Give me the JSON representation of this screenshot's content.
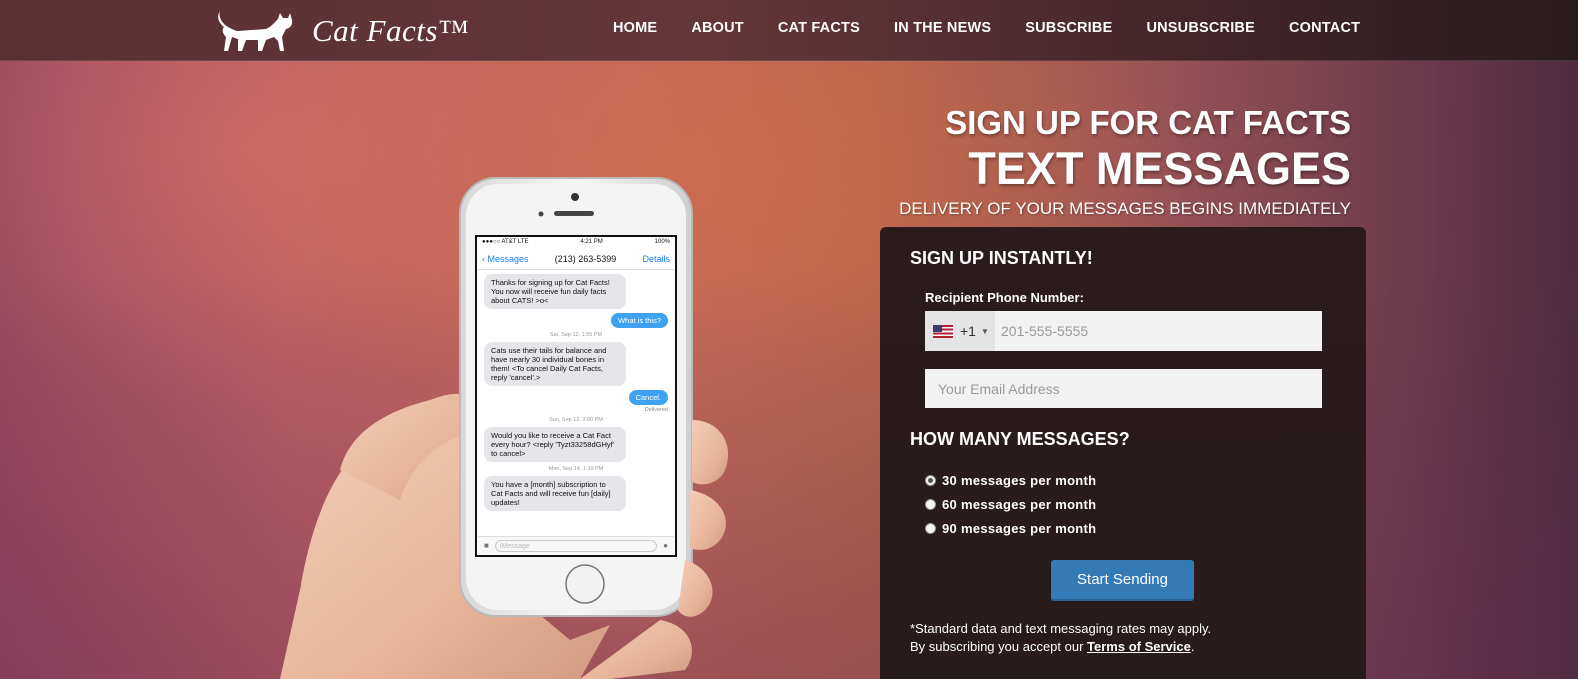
{
  "brand": {
    "name": "Cat Facts™"
  },
  "nav": [
    {
      "label": "HOME"
    },
    {
      "label": "ABOUT"
    },
    {
      "label": "CAT FACTS"
    },
    {
      "label": "IN THE NEWS"
    },
    {
      "label": "SUBSCRIBE"
    },
    {
      "label": "UNSUBSCRIBE"
    },
    {
      "label": "CONTACT"
    }
  ],
  "hero": {
    "line1": "SIGN UP FOR CAT FACTS",
    "line2": "TEXT MESSAGES",
    "line3": "DELIVERY OF YOUR MESSAGES BEGINS IMMEDIATELY"
  },
  "phone_screen": {
    "carrier": "●●●○○ AT&T LTE",
    "time": "4:21 PM",
    "battery": "100%",
    "back": "Messages",
    "contact": "(213) 263-5399",
    "details": "Details",
    "messages": [
      {
        "side": "in",
        "text": "Thanks for signing up for Cat Facts! You now will receive fun daily facts about CATS! >o<"
      },
      {
        "side": "out",
        "text": "What is this?"
      },
      {
        "side": "stamp",
        "text": "Sat, Sep 12, 1:55 PM"
      },
      {
        "side": "in",
        "text": "Cats use their tails for balance and have nearly 30 individual bones in them! <To cancel Daily Cat Facts, reply 'cancel'.>"
      },
      {
        "side": "out",
        "text": "Cancel."
      },
      {
        "side": "status",
        "text": "Delivered"
      },
      {
        "side": "stamp",
        "text": "Sun, Sep 13, 2:00 PM"
      },
      {
        "side": "in",
        "text": "Would you like to receive a Cat Fact every hour? <reply 'Tyzt33258dGHyf' to cancel>"
      },
      {
        "side": "stamp",
        "text": "Mon, Sep 14, 1:10 PM"
      },
      {
        "side": "in",
        "text": "You have a [month] subscription to Cat Facts and will receive fun [daily] updates!"
      }
    ],
    "composer_placeholder": "iMessage"
  },
  "form": {
    "heading": "SIGN UP INSTANTLY!",
    "phone_label": "Recipient Phone Number:",
    "country_code": "+1",
    "phone_placeholder": "201-555-5555",
    "email_placeholder": "Your Email Address",
    "messages_heading": "HOW MANY MESSAGES?",
    "options": [
      {
        "label": "30 messages per month",
        "checked": true
      },
      {
        "label": "60 messages per month",
        "checked": false
      },
      {
        "label": "90 messages per month",
        "checked": false
      }
    ],
    "submit_label": "Start Sending",
    "disclaimer_line1": "*Standard data and text messaging rates may apply.",
    "disclaimer_line2_prefix": "By subscribing you accept our ",
    "terms_link": "Terms of Service",
    "disclaimer_line2_suffix": "."
  },
  "colors": {
    "topbar": "#5a3034",
    "panel": "#2a1b1c",
    "button": "#337ab7",
    "bubble_out": "#3ea2f0",
    "bubble_in": "#e5e5ea"
  }
}
